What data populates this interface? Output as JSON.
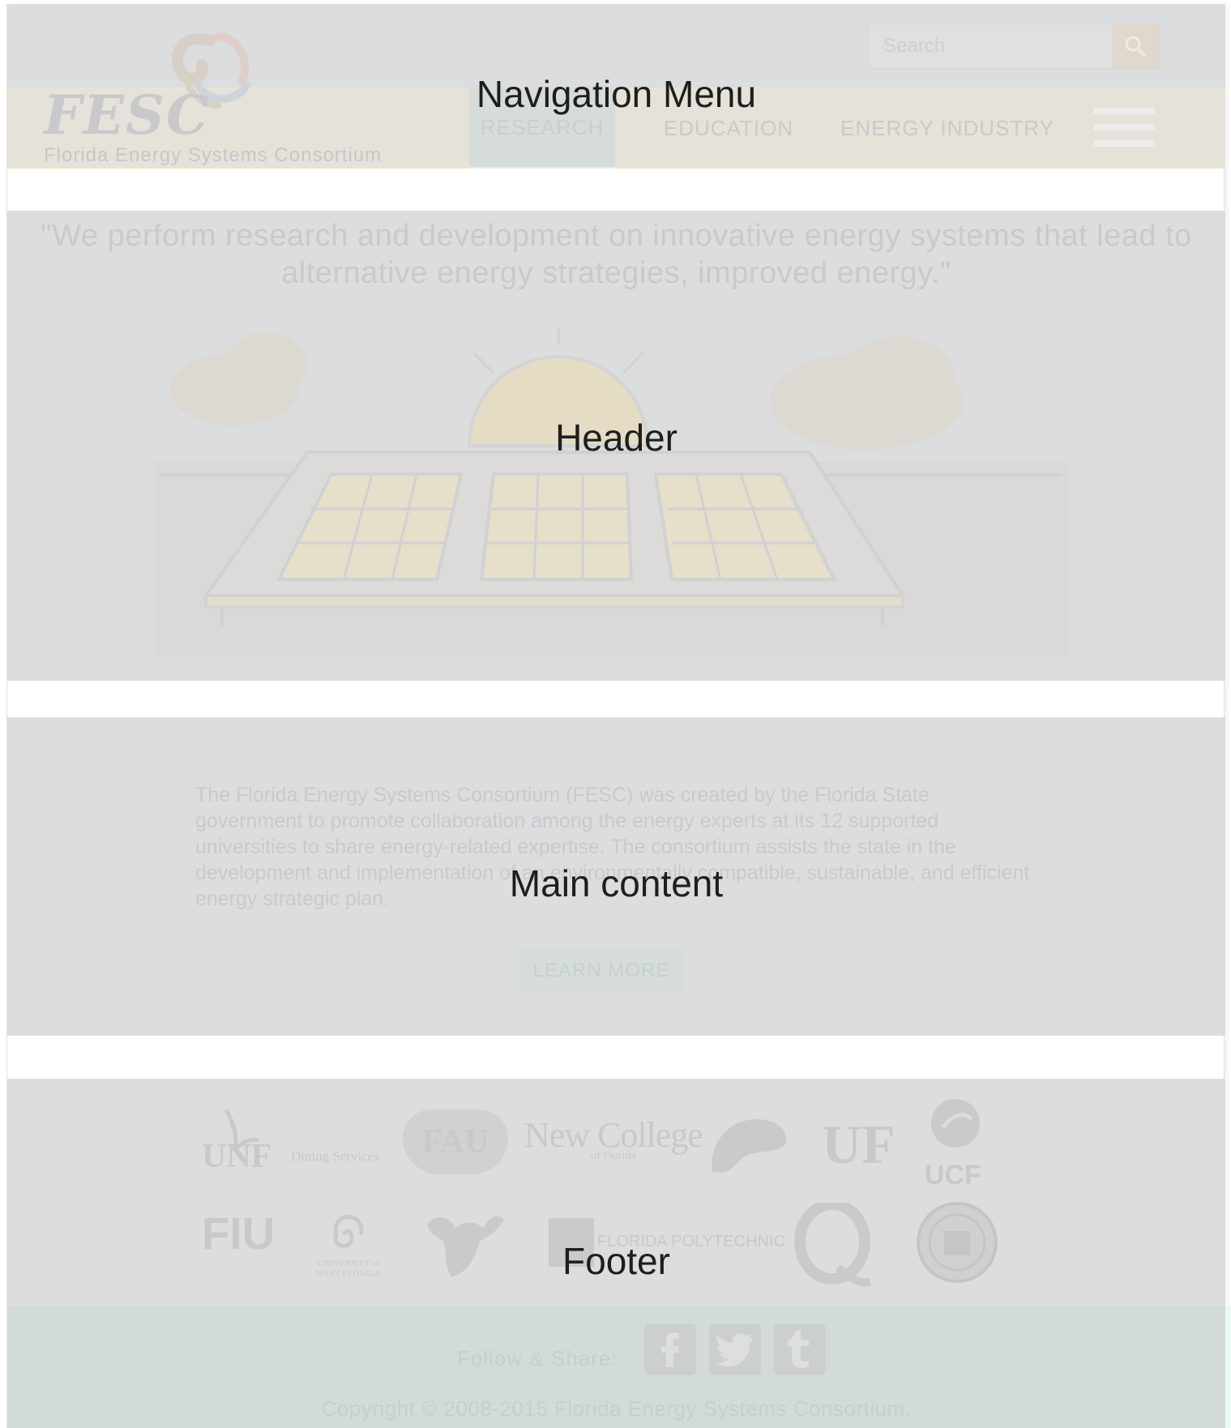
{
  "labels": {
    "navigation": "Navigation Menu",
    "header": "Header",
    "main": "Main content",
    "footer": "Footer"
  },
  "nav": {
    "logo_text": "FESC",
    "logo_subtitle": "Florida Energy Systems Consortium",
    "search_placeholder": "Search",
    "items": [
      {
        "label": "RESEARCH",
        "active": true
      },
      {
        "label": "EDUCATION",
        "active": false
      },
      {
        "label": "ENERGY INDUSTRY",
        "active": false
      }
    ]
  },
  "header": {
    "quote": "\"We perform research and development on innovative energy systems that lead to alternative energy strategies, improved energy.\""
  },
  "main": {
    "paragraph": "The Florida Energy Systems Consortium (FESC) was created by the Florida State government to promote collaboration among the energy experts at its 12 supported universities to share energy-related expertise. The consortium assists the state in the development and implementation of an environmentally compatible, sustainable, and efficient energy strategic plan.",
    "button": "LEARN MORE"
  },
  "footer": {
    "universities_row1": [
      "UNF",
      "Dining Services",
      "FAU",
      "New College",
      "of Florida",
      "UF",
      "UCF"
    ],
    "universities_row2": [
      "FIU",
      "UNIVERSITY of WEST FLORIDA",
      "FLORIDA POLYTECHNIC"
    ],
    "follow_label": "Follow & Share:",
    "social": [
      "facebook",
      "twitter",
      "tumblr"
    ],
    "copyright": "Copyright © 2008-2015 Florida Energy Systems Consortium."
  },
  "colors": {
    "overlay": "#dcdddf",
    "nav_band": "#e5e2da",
    "footer_band": "#d3dada",
    "label_text": "#1e1e1e"
  }
}
